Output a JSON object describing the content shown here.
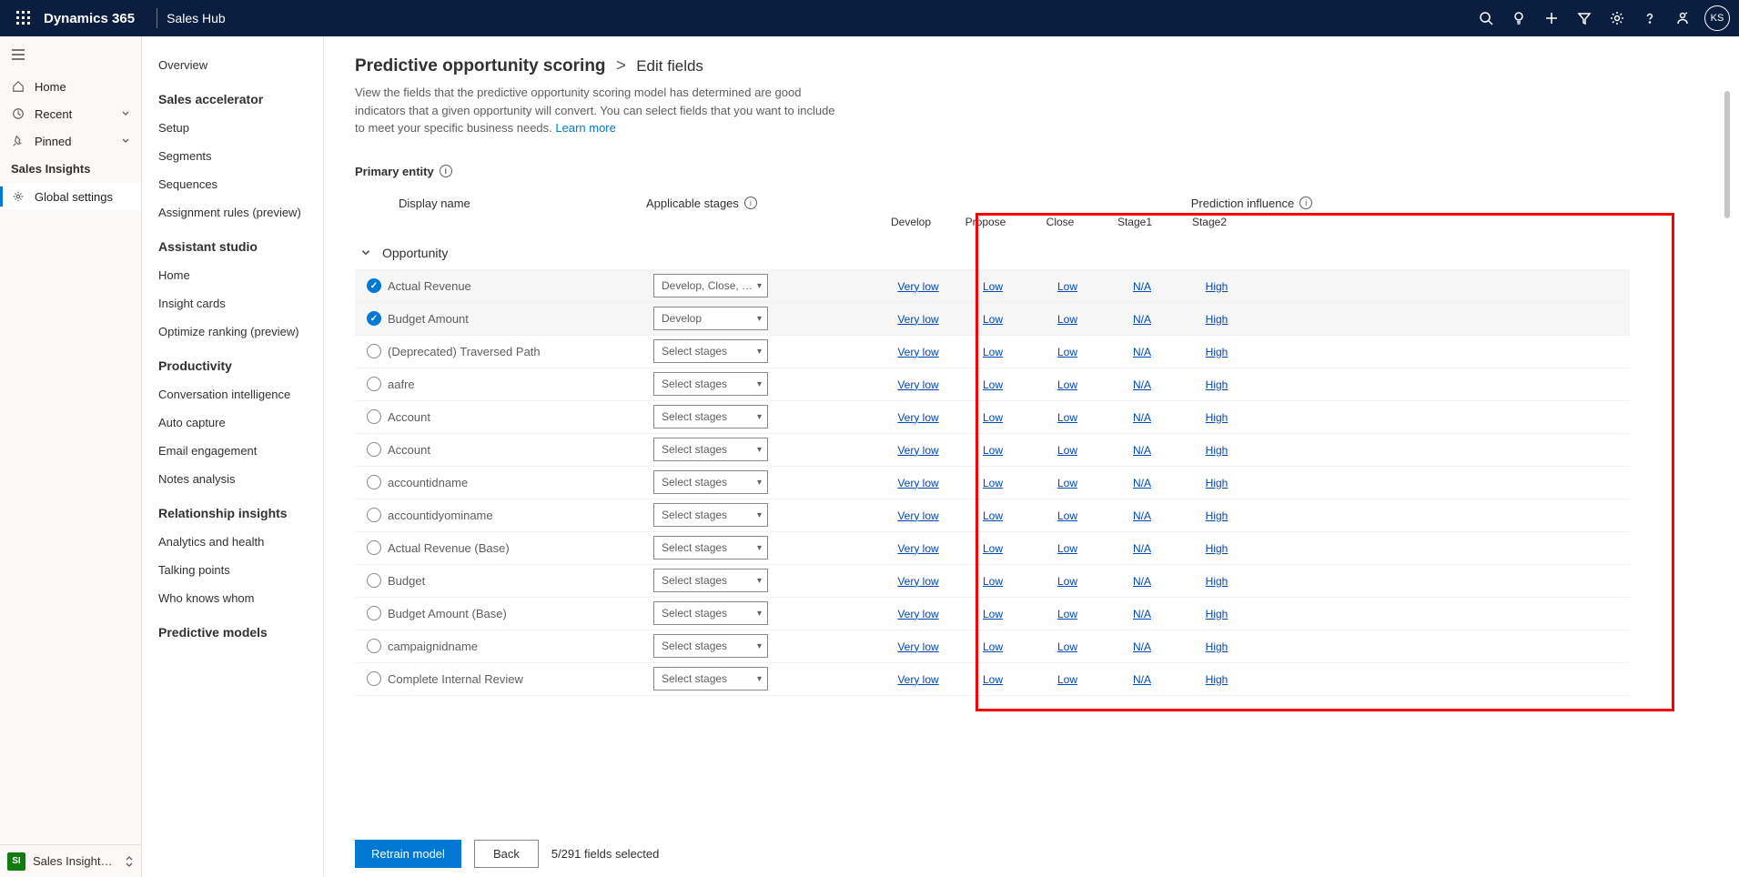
{
  "topbar": {
    "brand": "Dynamics 365",
    "app": "Sales Hub",
    "avatar": "KS"
  },
  "nav1": {
    "home": "Home",
    "recent": "Recent",
    "pinned": "Pinned",
    "section": "Sales Insights",
    "global": "Global settings",
    "switch_badge": "SI",
    "switch_label": "Sales Insights sett…"
  },
  "nav2": {
    "overview": "Overview",
    "h_sales_accel": "Sales accelerator",
    "setup": "Setup",
    "segments": "Segments",
    "sequences": "Sequences",
    "assignment": "Assignment rules (preview)",
    "h_assistant": "Assistant studio",
    "as_home": "Home",
    "insight_cards": "Insight cards",
    "optimize": "Optimize ranking (preview)",
    "h_productivity": "Productivity",
    "conv_intel": "Conversation intelligence",
    "auto_capture": "Auto capture",
    "email_eng": "Email engagement",
    "notes": "Notes analysis",
    "h_relationship": "Relationship insights",
    "analytics": "Analytics and health",
    "talking": "Talking points",
    "who_knows": "Who knows whom",
    "h_predictive": "Predictive models"
  },
  "page": {
    "crumb1": "Predictive opportunity scoring",
    "crumb2": "Edit fields",
    "desc": "View the fields that the predictive opportunity scoring model has determined are good indicators that a given opportunity will convert. You can select fields that you want to include to meet your specific business needs. ",
    "learn_more": "Learn more",
    "primary_entity": "Primary entity",
    "col_display": "Display name",
    "col_stages": "Applicable stages",
    "col_pred": "Prediction influence",
    "entity_name": "Opportunity",
    "stages": [
      "Develop",
      "Propose",
      "Close",
      "Stage1",
      "Stage2"
    ],
    "stage_placeholder": "Select stages",
    "rows": [
      {
        "selected": true,
        "name": "Actual Revenue",
        "stage_val": "Develop, Close, …",
        "inf": [
          "Very low",
          "Low",
          "Low",
          "N/A",
          "High"
        ]
      },
      {
        "selected": true,
        "name": "Budget Amount",
        "stage_val": "Develop",
        "inf": [
          "Very low",
          "Low",
          "Low",
          "N/A",
          "High"
        ]
      },
      {
        "selected": false,
        "name": "(Deprecated) Traversed Path",
        "stage_val": "",
        "inf": [
          "Very low",
          "Low",
          "Low",
          "N/A",
          "High"
        ]
      },
      {
        "selected": false,
        "name": "aafre",
        "stage_val": "",
        "inf": [
          "Very low",
          "Low",
          "Low",
          "N/A",
          "High"
        ]
      },
      {
        "selected": false,
        "name": "Account",
        "stage_val": "",
        "inf": [
          "Very low",
          "Low",
          "Low",
          "N/A",
          "High"
        ]
      },
      {
        "selected": false,
        "name": "Account",
        "stage_val": "",
        "inf": [
          "Very low",
          "Low",
          "Low",
          "N/A",
          "High"
        ]
      },
      {
        "selected": false,
        "name": "accountidname",
        "stage_val": "",
        "inf": [
          "Very low",
          "Low",
          "Low",
          "N/A",
          "High"
        ]
      },
      {
        "selected": false,
        "name": "accountidyominame",
        "stage_val": "",
        "inf": [
          "Very low",
          "Low",
          "Low",
          "N/A",
          "High"
        ]
      },
      {
        "selected": false,
        "name": "Actual Revenue (Base)",
        "stage_val": "",
        "inf": [
          "Very low",
          "Low",
          "Low",
          "N/A",
          "High"
        ]
      },
      {
        "selected": false,
        "name": "Budget",
        "stage_val": "",
        "inf": [
          "Very low",
          "Low",
          "Low",
          "N/A",
          "High"
        ]
      },
      {
        "selected": false,
        "name": "Budget Amount (Base)",
        "stage_val": "",
        "inf": [
          "Very low",
          "Low",
          "Low",
          "N/A",
          "High"
        ]
      },
      {
        "selected": false,
        "name": "campaignidname",
        "stage_val": "",
        "inf": [
          "Very low",
          "Low",
          "Low",
          "N/A",
          "High"
        ]
      },
      {
        "selected": false,
        "name": "Complete Internal Review",
        "stage_val": "",
        "inf": [
          "Very low",
          "Low",
          "Low",
          "N/A",
          "High"
        ]
      }
    ]
  },
  "footer": {
    "retrain": "Retrain model",
    "back": "Back",
    "count": "5/291 fields selected"
  }
}
